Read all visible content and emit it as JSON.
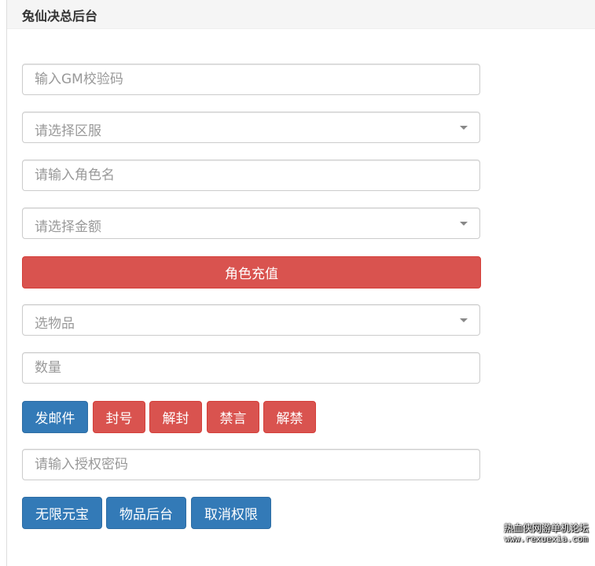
{
  "panel": {
    "title": "兔仙决总后台"
  },
  "form": {
    "gm_code_placeholder": "输入GM校验码",
    "server_select_placeholder": "请选择区服",
    "role_name_placeholder": "请输入角色名",
    "amount_select_placeholder": "请选择金额",
    "recharge_button": "角色充值",
    "item_select_placeholder": "选物品",
    "quantity_placeholder": "数量",
    "auth_password_placeholder": "请输入授权密码"
  },
  "actions": {
    "send_mail": "发邮件",
    "ban": "封号",
    "unban": "解封",
    "mute": "禁言",
    "unmute": "解禁",
    "unlimited_yuanbao": "无限元宝",
    "item_backend": "物品后台",
    "revoke_permission": "取消权限"
  },
  "watermark": {
    "line1": "热血侠网游单机论坛",
    "line2": "www.rexuexia.com"
  },
  "colors": {
    "danger": "#d9534f",
    "primary": "#337ab7",
    "heading_bg": "#f5f5f5"
  }
}
